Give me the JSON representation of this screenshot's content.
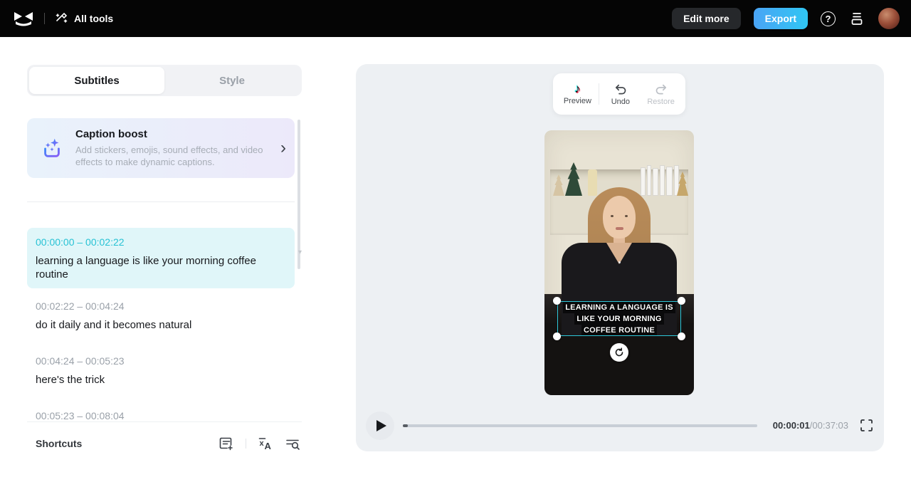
{
  "topbar": {
    "all_tools_label": "All tools",
    "edit_more_label": "Edit more",
    "export_label": "Export",
    "export_color": "#3db9f3",
    "background_color": "#050505"
  },
  "sidebar": {
    "tabs": [
      {
        "label": "Subtitles",
        "active": true
      },
      {
        "label": "Style",
        "active": false
      }
    ],
    "caption_boost": {
      "title": "Caption boost",
      "description": "Add stickers, emojis, sound effects, and video effects to make dynamic captions."
    },
    "subtitles": [
      {
        "time": "00:00:00 – 00:02:22",
        "text": "learning a language is like your morning coffee routine",
        "active": true
      },
      {
        "time": "00:02:22 – 00:04:24",
        "text": "do it daily and it becomes natural",
        "active": false
      },
      {
        "time": "00:04:24 – 00:05:23",
        "text": "here's the trick",
        "active": false
      },
      {
        "time": "00:05:23 – 00:08:04",
        "text": "",
        "active": false,
        "clipped": true
      }
    ],
    "shortcuts_label": "Shortcuts",
    "active_time_color": "#27c2d4",
    "active_row_color": "#e0f6f9"
  },
  "preview": {
    "toolbar": {
      "preview_label": "Preview",
      "undo_label": "Undo",
      "restore_label": "Restore",
      "restore_disabled": true
    },
    "caption_lines": [
      "LEARNING A LANGUAGE IS",
      "LIKE YOUR MORNING",
      "COFFEE ROUTINE"
    ],
    "selection_color": "#2ec7d9",
    "player": {
      "current_time": "00:00:01",
      "time_separator": "/",
      "total_time": "00:37:03",
      "progress_percent": 0.5,
      "playing": false
    }
  },
  "icons": {
    "help_glyph": "?",
    "chevron_glyph": "›",
    "tiktok_note_glyph": "♪",
    "scroll_hint_glyph": "▾"
  }
}
